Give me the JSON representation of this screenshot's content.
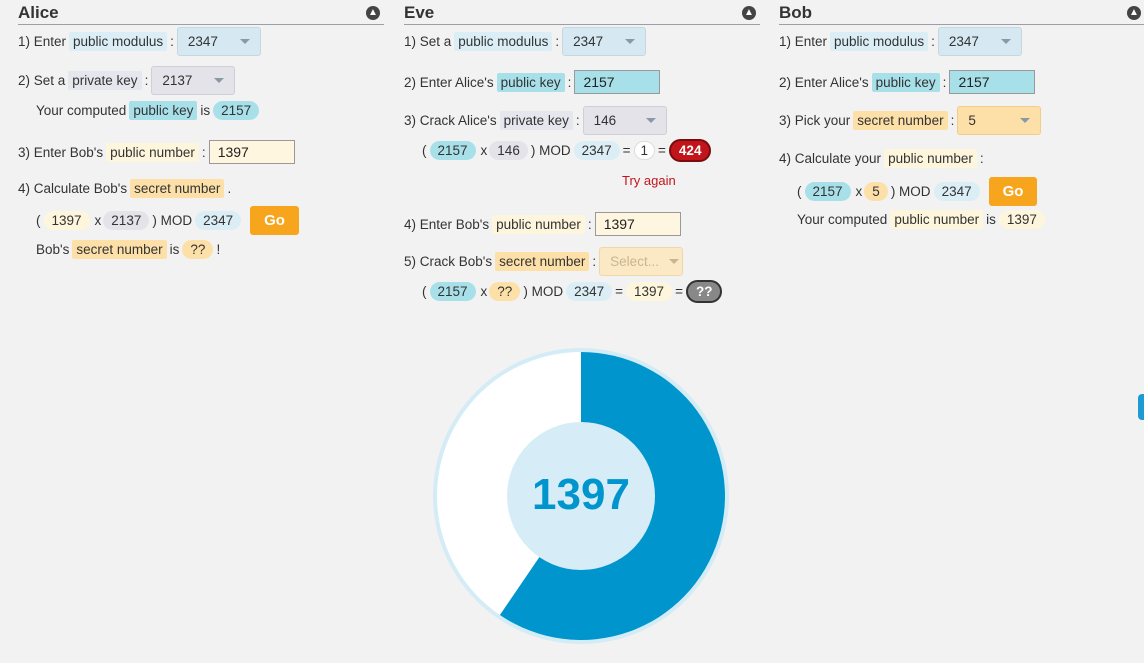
{
  "colors": {
    "pie_fill": "#0095cc",
    "pie_rest": "#ffffff",
    "go": "#f7a51c",
    "error": "#c1151b"
  },
  "alice": {
    "title": "Alice",
    "step1": {
      "prefix": "1)  Enter",
      "term": "public modulus",
      "colon": ":",
      "value": "2347"
    },
    "step2": {
      "prefix": "2) Set a",
      "term": "private key",
      "colon": ":",
      "value": "2137"
    },
    "computed": {
      "prefix": "Your computed",
      "term": "public key",
      "mid": "is",
      "value": "2157"
    },
    "step3": {
      "prefix": "3) Enter Bob's",
      "term": "public number",
      "colon": ":",
      "value": "1397"
    },
    "step4": {
      "prefix": "4) Calculate Bob's",
      "term": "secret number",
      "suffix": "."
    },
    "formula": {
      "open": "(",
      "a": "1397",
      "times": "x",
      "b": "2137",
      "mod": ") MOD",
      "m": "2347",
      "go": "Go"
    },
    "result": {
      "prefix": "Bob's",
      "term": "secret number",
      "mid": "is",
      "value": "??",
      "suffix": "!"
    }
  },
  "eve": {
    "title": "Eve",
    "step1": {
      "prefix": "1) Set a",
      "term": "public modulus",
      "colon": ":",
      "value": "2347"
    },
    "step2": {
      "prefix": "2) Enter Alice's",
      "term": "public key",
      "colon": ":",
      "value": "2157"
    },
    "step3": {
      "prefix": "3) Crack Alice's",
      "term": "private key",
      "colon": ":",
      "value": "146"
    },
    "formula1": {
      "open": "(",
      "a": "2157",
      "times": "x",
      "b": "146",
      "mod": ") MOD",
      "m": "2347",
      "eq": "=",
      "r": "1",
      "eq2": "=",
      "result": "424"
    },
    "try_again": "Try again",
    "step4": {
      "prefix": "4) Enter Bob's",
      "term": "public number",
      "colon": ":",
      "value": "1397"
    },
    "step5": {
      "prefix": "5) Crack Bob's",
      "term": "secret number",
      "colon": ":",
      "placeholder": "Select..."
    },
    "formula2": {
      "open": "(",
      "a": "2157",
      "times": "x",
      "b": "??",
      "mod": ") MOD",
      "m": "2347",
      "eq": "=",
      "r": "1397",
      "eq2": "=",
      "result": "??"
    }
  },
  "bob": {
    "title": "Bob",
    "step1": {
      "prefix": "1)  Enter",
      "term": "public modulus",
      "colon": ":",
      "value": "2347"
    },
    "step2": {
      "prefix": "2) Enter Alice's",
      "term": "public key",
      "colon": ":",
      "value": "2157"
    },
    "step3": {
      "prefix": "3) Pick your",
      "term": "secret number",
      "colon": ":",
      "value": "5"
    },
    "step4": {
      "prefix": "4) Calculate your",
      "term": "public number",
      "colon": ":"
    },
    "formula": {
      "open": "(",
      "a": "2157",
      "times": "x",
      "b": "5",
      "mod": ") MOD",
      "m": "2347",
      "go": "Go"
    },
    "computed": {
      "prefix": "Your computed",
      "term": "public number",
      "mid": "is",
      "value": "1397"
    }
  },
  "gauge": {
    "value": "1397",
    "modulus": 2347,
    "fraction": 0.5952
  }
}
